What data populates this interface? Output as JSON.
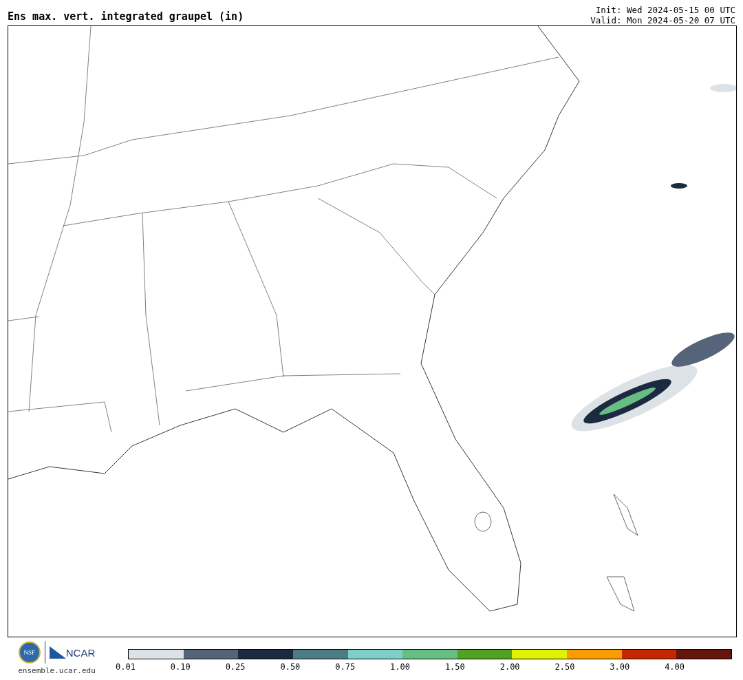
{
  "title": "Ens max. vert. integrated graupel (in)",
  "init": "Init: Wed 2024-05-15 00 UTC",
  "valid": "Valid: Mon 2024-05-20 07 UTC",
  "logos": {
    "nsf": "NSF",
    "ncar": "NCAR",
    "site": "ensemble.ucar.edu"
  },
  "legend": {
    "bins": [
      {
        "label": "0.01",
        "color": "#dde2e6"
      },
      {
        "label": "0.10",
        "color": "#566479"
      },
      {
        "label": "0.25",
        "color": "#1b2a40"
      },
      {
        "label": "0.50",
        "color": "#4b7d83"
      },
      {
        "label": "0.75",
        "color": "#80cec8"
      },
      {
        "label": "1.00",
        "color": "#68bd82"
      },
      {
        "label": "1.50",
        "color": "#4fa223"
      },
      {
        "label": "2.00",
        "color": "#dff300"
      },
      {
        "label": "2.50",
        "color": "#fb9d00"
      },
      {
        "label": "3.00",
        "color": "#c52700"
      },
      {
        "label": "4.00",
        "color": "#63160c"
      }
    ]
  }
}
